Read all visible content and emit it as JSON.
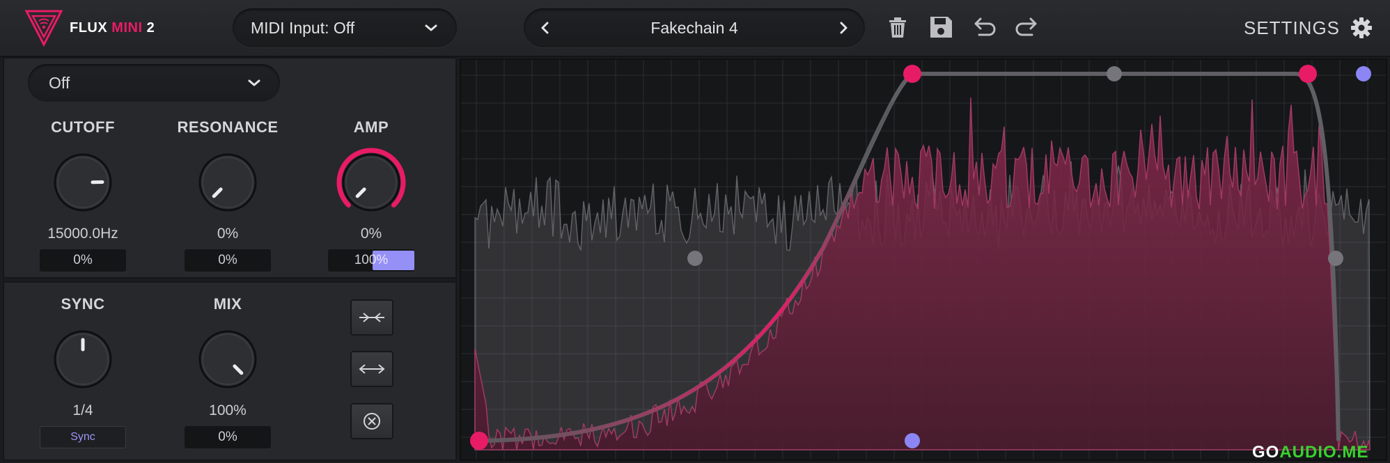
{
  "header": {
    "logo_flux": "FLUX",
    "logo_mini": "MINI",
    "logo_version": "2",
    "midi_label": "MIDI Input: Off",
    "preset_name": "Fakechain 4",
    "settings_label": "SETTINGS"
  },
  "trigger_dropdown": {
    "value": "Off"
  },
  "knobs": {
    "cutoff": {
      "label": "CUTOFF",
      "value": "15000.0Hz",
      "mod": "0%",
      "level": 0.83
    },
    "resonance": {
      "label": "RESONANCE",
      "value": "0%",
      "mod": "0%",
      "level": 0.0
    },
    "amp": {
      "label": "AMP",
      "value": "0%",
      "mod": "100%",
      "level": 0.0,
      "mod_level": 1.0
    },
    "sync": {
      "label": "SYNC",
      "value": "1/4",
      "mod": "Sync",
      "level": 0.5
    },
    "mix": {
      "label": "MIX",
      "value": "100%",
      "mod": "0%",
      "level": 1.0
    }
  },
  "side_buttons": [
    "compress-icon",
    "expand-icon",
    "reset-icon"
  ],
  "colors": {
    "accent": "#e81b67",
    "secondary": "#8c86f5",
    "curve": "#5a5a5e"
  },
  "watermark": {
    "prefix": "GO",
    "suffix": "AUDIO.ME"
  }
}
